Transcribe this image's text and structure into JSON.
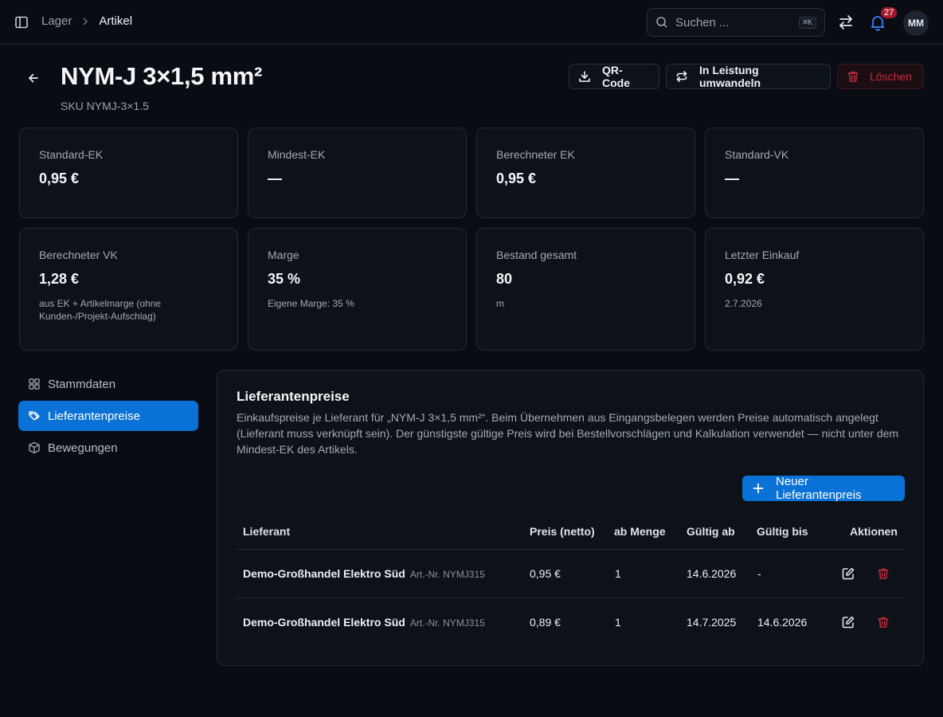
{
  "breadcrumb": {
    "parent": "Lager",
    "current": "Artikel"
  },
  "search": {
    "placeholder": "Suchen ...",
    "shortcut": "⌘K"
  },
  "notifications": {
    "count": "27"
  },
  "user": {
    "initials": "MM"
  },
  "article": {
    "title": "NYM-J 3×1,5 mm²",
    "sku": "SKU NYMJ-3×1.5"
  },
  "actions": {
    "qr": "QR-Code",
    "convert": "In Leistung umwandeln",
    "delete": "Löschen"
  },
  "stats": [
    {
      "label": "Standard-EK",
      "value": "0,95 €",
      "sub": ""
    },
    {
      "label": "Mindest-EK",
      "value": "—",
      "sub": ""
    },
    {
      "label": "Berechneter EK",
      "value": "0,95 €",
      "sub": ""
    },
    {
      "label": "Standard-VK",
      "value": "—",
      "sub": ""
    },
    {
      "label": "Berechneter VK",
      "value": "1,28 €",
      "sub": "aus EK + Artikelmarge (ohne Kunden-/Projekt-Aufschlag)"
    },
    {
      "label": "Marge",
      "value": "35 %",
      "sub": "Eigene Marge: 35 %"
    },
    {
      "label": "Bestand gesamt",
      "value": "80",
      "sub": "m"
    },
    {
      "label": "Letzter Einkauf",
      "value": "0,92 €",
      "sub": "2.7.2026"
    }
  ],
  "nav": [
    {
      "label": "Stammdaten",
      "icon": "grid-icon"
    },
    {
      "label": "Lieferantenpreise",
      "icon": "tags-icon"
    },
    {
      "label": "Bewegungen",
      "icon": "box-icon"
    }
  ],
  "panel": {
    "title": "Lieferantenpreise",
    "description": "Einkaufspreise je Lieferant für „NYM-J 3×1,5 mm²“. Beim Übernehmen aus Eingangsbelegen werden Preise automatisch angelegt (Lieferant muss verknüpft sein). Der günstigste gültige Preis wird bei Bestellvorschlägen und Kalkulation verwendet — nicht unter dem Mindest-EK des Artikels.",
    "add_label": "Neuer Lieferantenpreis"
  },
  "table": {
    "headers": [
      "Lieferant",
      "Preis (netto)",
      "ab Menge",
      "Gültig ab",
      "Gültig bis",
      "Aktionen"
    ],
    "rows": [
      {
        "supplier": "Demo-Großhandel Elektro Süd",
        "artnr": "Art.-Nr. NYMJ315",
        "price": "0,95 €",
        "qty": "1",
        "from": "14.6.2026",
        "to": "-"
      },
      {
        "supplier": "Demo-Großhandel Elektro Süd",
        "artnr": "Art.-Nr. NYMJ315",
        "price": "0,89 €",
        "qty": "1",
        "from": "14.7.2025",
        "to": "14.6.2026"
      }
    ]
  },
  "colors": {
    "accent": "#0a72d6",
    "danger": "#c42b3e",
    "background": "#090c12",
    "card": "#0d1118"
  }
}
